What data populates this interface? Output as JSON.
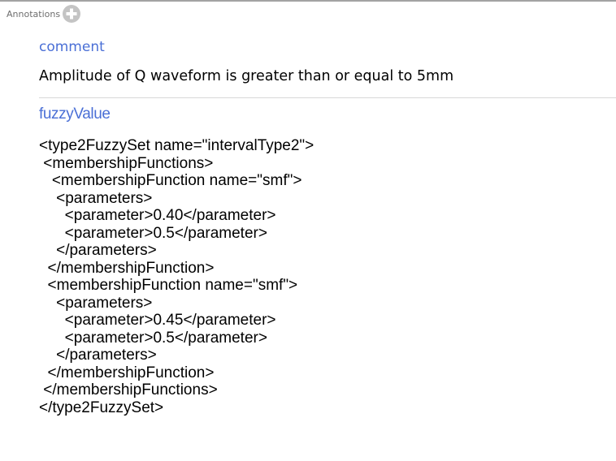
{
  "annotations": {
    "header_label": "Annotations",
    "add_icon": "plus-icon",
    "colors": {
      "key": "#4a6fd6",
      "header": "#6e6e6e",
      "add_button": "#c4c4c4"
    },
    "items": [
      {
        "key": "comment",
        "value": "Amplitude of Q waveform is greater than or equal to 5mm"
      },
      {
        "key": "fuzzyValue",
        "value_lines": [
          "<type2FuzzySet name=\"intervalType2\">",
          " <membershipFunctions>",
          "   <membershipFunction name=\"smf\">",
          "    <parameters>",
          "      <parameter>0.40</parameter>",
          "      <parameter>0.5</parameter>",
          "    </parameters>",
          "  </membershipFunction>",
          "  <membershipFunction name=\"smf\">",
          "    <parameters>",
          "      <parameter>0.45</parameter>",
          "      <parameter>0.5</parameter>",
          "    </parameters>",
          "  </membershipFunction>",
          " </membershipFunctions>",
          "</type2FuzzySet>"
        ]
      }
    ]
  }
}
